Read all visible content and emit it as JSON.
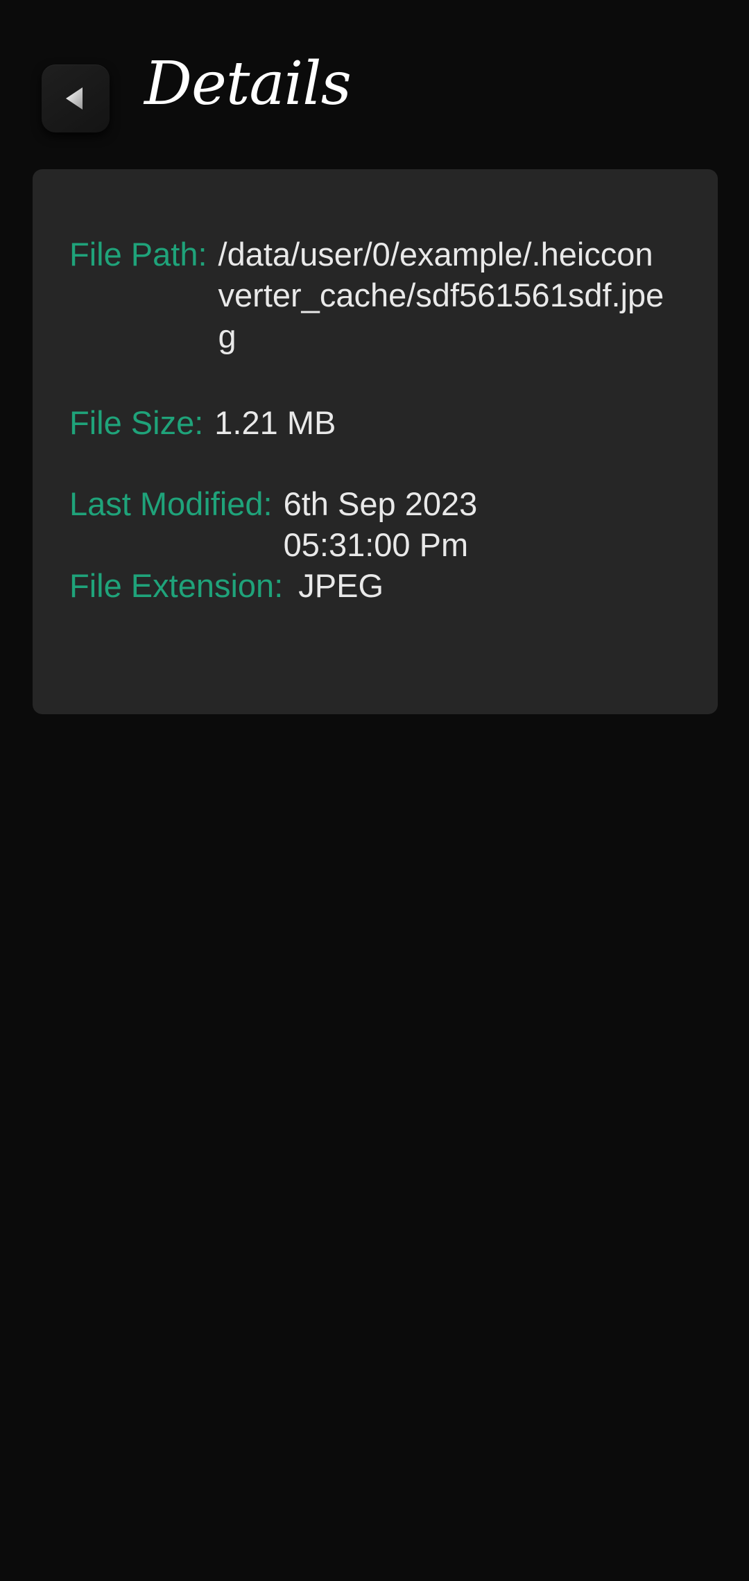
{
  "header": {
    "title": "Details",
    "back_icon": "back-arrow-icon"
  },
  "details": {
    "file_path": {
      "label": "File Path:",
      "value": "/data/user/0/example/.heicconverter_cache/sdf561561sdf.jpeg"
    },
    "file_size": {
      "label": "File Size:",
      "value": "1.21 MB"
    },
    "last_modified": {
      "label": "Last Modified:",
      "value": "6th Sep 2023 05:31:00 Pm"
    },
    "file_extension": {
      "label": "File Extension:",
      "value": "JPEG"
    }
  },
  "colors": {
    "background": "#0b0b0b",
    "card": "#262626",
    "label": "#1fa37a",
    "value": "#e9e9e9"
  }
}
